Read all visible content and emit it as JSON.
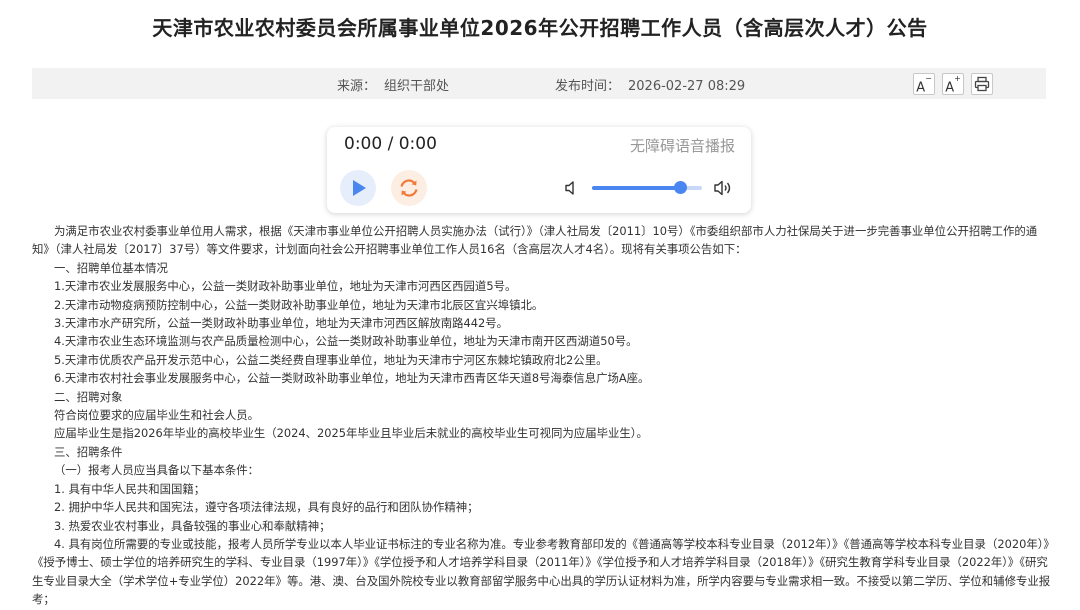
{
  "title": "天津市农业农村委员会所属事业单位2026年公开招聘工作人员（含高层次人才）公告",
  "meta": {
    "source_label": "来源：",
    "source_value": "组织干部处",
    "date_label": "发布时间：",
    "date_value": "2026-02-27 08:29"
  },
  "toolbar": {
    "font_small": "A",
    "font_small_sup": "−",
    "font_large": "A",
    "font_large_sup": "+"
  },
  "player": {
    "time": "0:00 / 0:00",
    "label": "无障碍语音播报",
    "volume": 0.8,
    "accent": "#4a86f0",
    "replay_color": "#f07a3a"
  },
  "article": {
    "intro": "为满足市农业农村委事业单位用人需求，根据《天津市事业单位公开招聘人员实施办法（试行）》（津人社局发〔2011〕10号）《市委组织部市人力社保局关于进一步完善事业单位公开招聘工作的通知》（津人社局发〔2017〕37号）等文件要求，计划面向社会公开招聘事业单位工作人员16名（含高层次人才4名）。现将有关事项公告如下：",
    "sec1": "一、招聘单位基本情况",
    "units": [
      "1.天津市农业发展服务中心，公益一类财政补助事业单位，地址为天津市河西区西园道5号。",
      "2.天津市动物疫病预防控制中心，公益一类财政补助事业单位，地址为天津市北辰区宜兴埠镇北。",
      "3.天津市水产研究所，公益一类财政补助事业单位，地址为天津市河西区解放南路442号。",
      "4.天津市农业生态环境监测与农产品质量检测中心，公益一类财政补助事业单位，地址为天津市南开区西湖道50号。",
      "5.天津市优质农产品开发示范中心，公益二类经费自理事业单位，地址为天津市宁河区东棘坨镇政府北2公里。",
      "6.天津市农村社会事业发展服务中心，公益一类财政补助事业单位，地址为天津市西青区华天道8号海泰信息广场A座。"
    ],
    "sec2": "二、招聘对象",
    "target1": "符合岗位要求的应届毕业生和社会人员。",
    "target2": "应届毕业生是指2026年毕业的高校毕业生（2024、2025年毕业且毕业后未就业的高校毕业生可视同为应届毕业生）。",
    "sec3": "三、招聘条件",
    "cond_head": "（一）报考人员应当具备以下基本条件：",
    "conds": [
      "1. 具有中华人民共和国国籍；",
      "2. 拥护中华人民共和国宪法，遵守各项法律法规，具有良好的品行和团队协作精神；",
      "3. 热爱农业农村事业，具备较强的事业心和奉献精神；"
    ],
    "cond4": "4. 具有岗位所需要的专业或技能，报考人员所学专业以本人毕业证书标注的专业名称为准。专业参考教育部印发的《普通高等学校本科专业目录（2012年）》《普通高等学校本科专业目录（2020年）》《授予博士、硕士学位的培养研究生的学科、专业目录（1997年）》《学位授予和人才培养学科目录（2011年）》《学位授予和人才培养学科目录（2018年）》《研究生教育学科专业目录（2022年）》《研究生专业目录大全（学术学位+专业学位）2022年》等。港、澳、台及国外院校专业以教育部留学服务中心出具的学历认证材料为准，所学内容要与专业需求相一致。不接受以第二学历、学位和辅修专业报考；"
  }
}
